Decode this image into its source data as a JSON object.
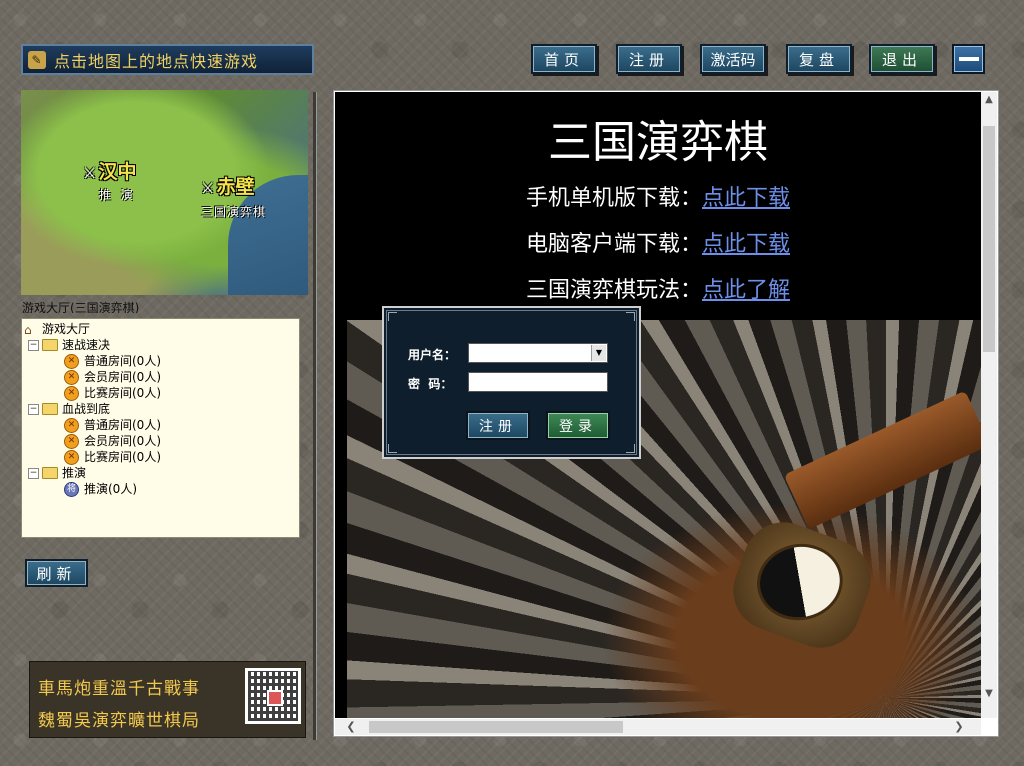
{
  "banner": {
    "text": "点击地图上的地点快速游戏"
  },
  "topnav": [
    {
      "label": "首页"
    },
    {
      "label": "注册"
    },
    {
      "label": "激活码"
    },
    {
      "label": "复盘"
    },
    {
      "label": "退出"
    }
  ],
  "map": {
    "locations": [
      {
        "name": "汉中",
        "sub": "推 演"
      },
      {
        "name": "赤壁",
        "sub": "三国演弈棋"
      }
    ]
  },
  "cut_label": "游戏大厅(三国演弈棋)",
  "tree": {
    "root": "游戏大厅",
    "groups": [
      {
        "name": "速战速决",
        "rooms": [
          "普通房间(0人)",
          "会员房间(0人)",
          "比赛房间(0人)"
        ]
      },
      {
        "name": "血战到底",
        "rooms": [
          "普通房间(0人)",
          "会员房间(0人)",
          "比赛房间(0人)"
        ]
      },
      {
        "name": "推演",
        "rooms": [
          "推演(0人)"
        ]
      }
    ]
  },
  "refresh_label": "刷新",
  "ad": {
    "line1": "車馬炮重溫千古戰事",
    "line2": "魏蜀吳演弈曠世棋局"
  },
  "content": {
    "title": "三国演弈棋",
    "rows": [
      {
        "label": "手机单机版下载：",
        "link": "点此下载"
      },
      {
        "label": "电脑客户端下载：",
        "link": "点此下载"
      },
      {
        "label": "三国演弈棋玩法：",
        "link": "点此了解"
      }
    ]
  },
  "login": {
    "username_label": "用户名：",
    "password_label": "密  码：",
    "username_value": "",
    "password_value": "",
    "register_label": "注册",
    "login_label": "登录"
  },
  "colors": {
    "link": "#6d8fe8",
    "banner_text": "#f0d060",
    "location_text": "#f5e34a"
  }
}
